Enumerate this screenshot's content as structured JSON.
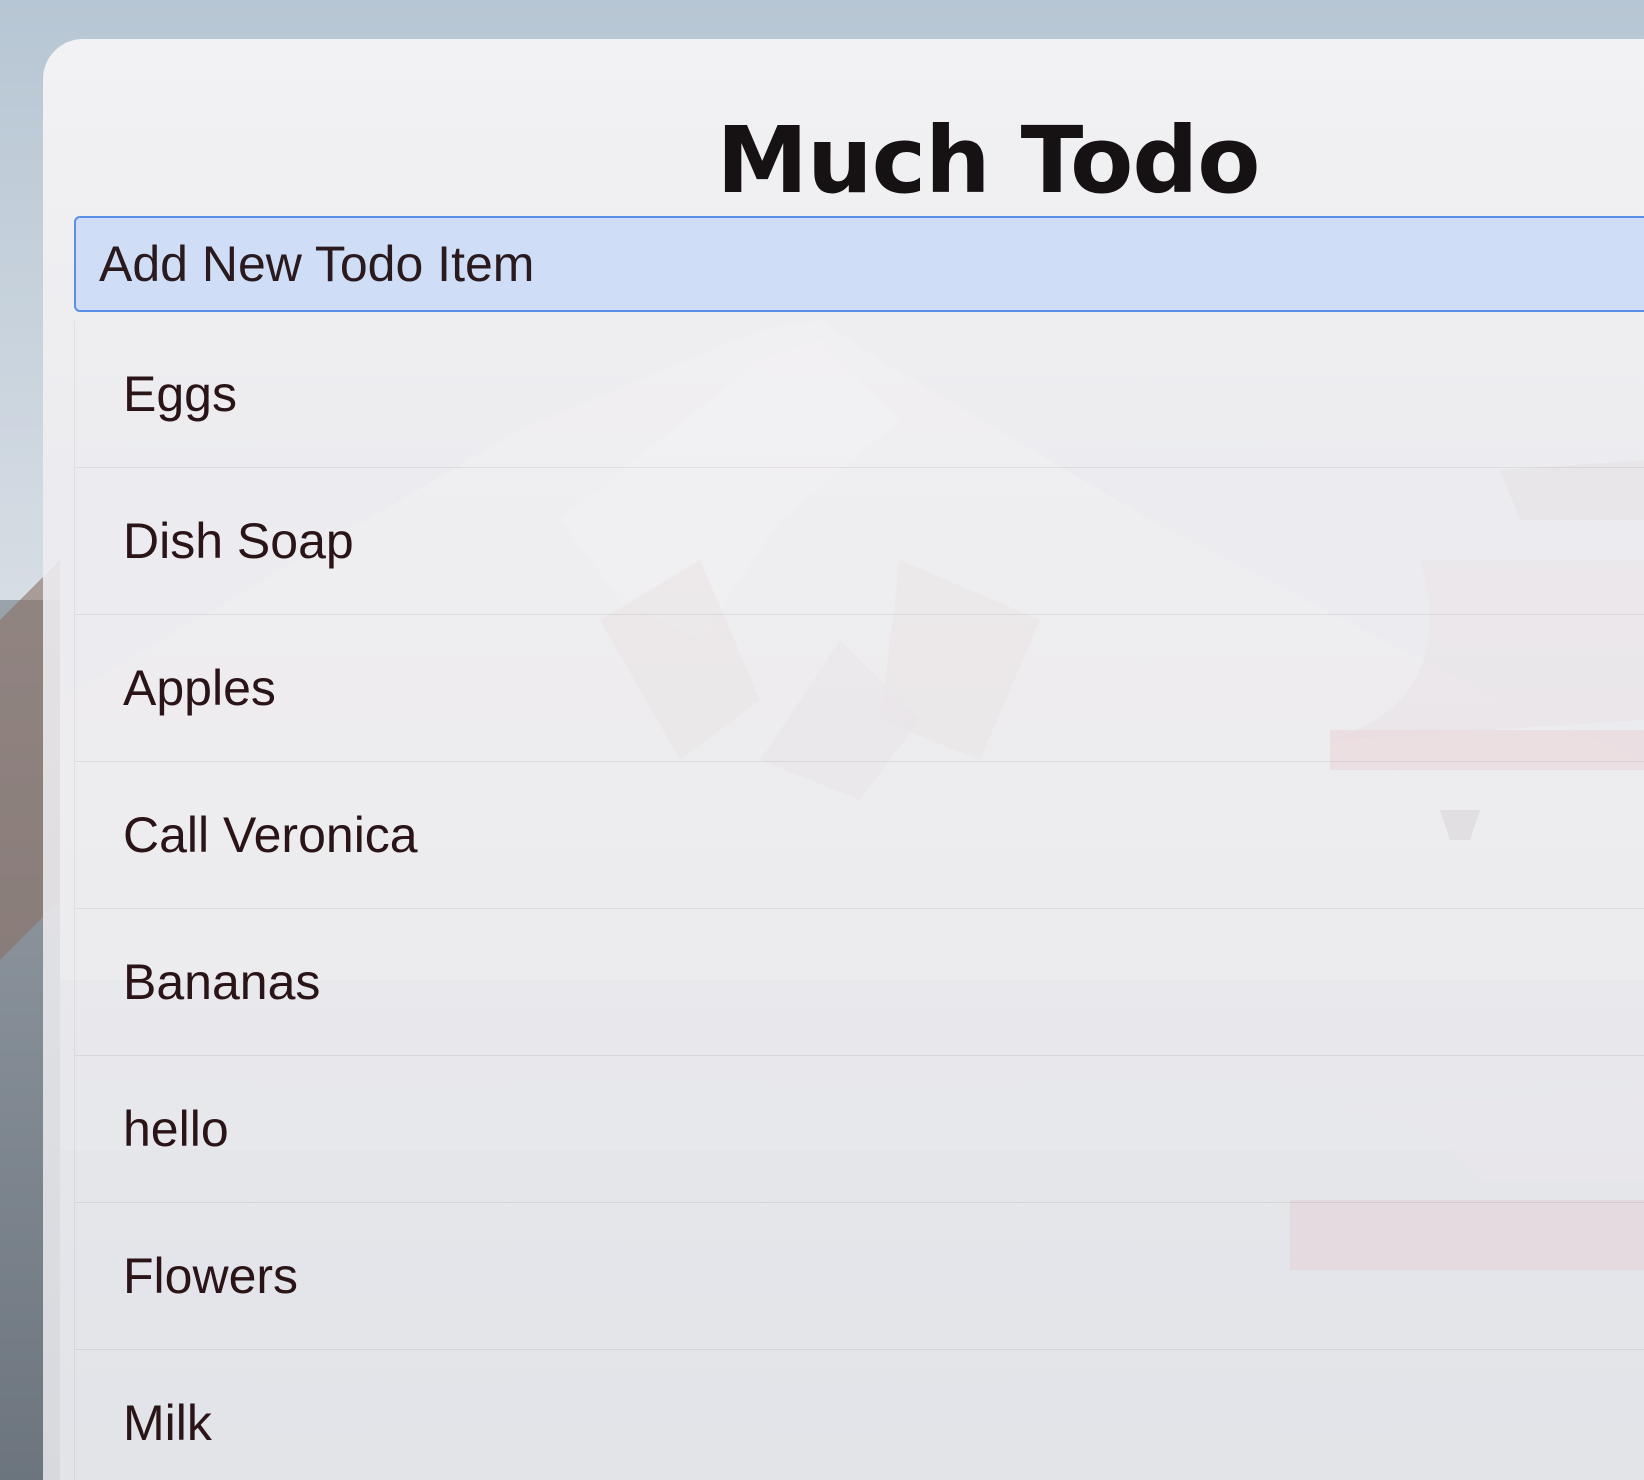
{
  "app": {
    "title": "Much Todo"
  },
  "new_item": {
    "placeholder": "Add New Todo Item",
    "value": ""
  },
  "todos": [
    {
      "label": "Eggs"
    },
    {
      "label": "Dish Soap"
    },
    {
      "label": "Apples"
    },
    {
      "label": "Call Veronica"
    },
    {
      "label": "Bananas"
    },
    {
      "label": "hello"
    },
    {
      "label": "Flowers"
    },
    {
      "label": "Milk"
    }
  ],
  "colors": {
    "input_background": "#ccdbf7",
    "input_border": "#5b8fe6",
    "title_text": "#161214",
    "item_text": "#2a1418",
    "pagoda_red": "#c2262d"
  },
  "background": {
    "description_icon": "mountain-pagoda-photo"
  }
}
